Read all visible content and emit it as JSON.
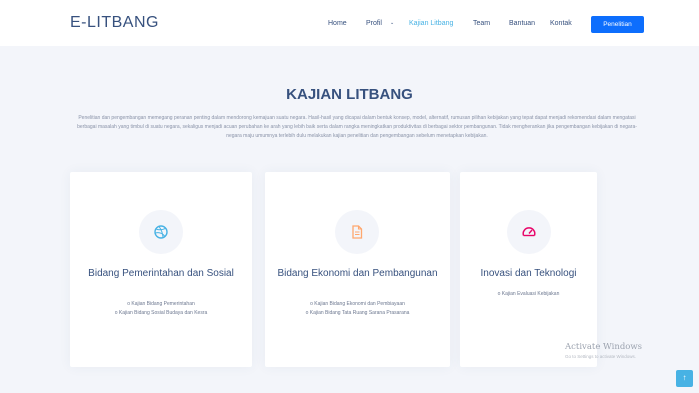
{
  "brand": {
    "logo": "E-LITBANG"
  },
  "nav": {
    "items": [
      {
        "label": "Home"
      },
      {
        "label": "Profil"
      },
      {
        "label": "Kajian Litbang"
      },
      {
        "label": "Team"
      },
      {
        "label": "Bantuan"
      },
      {
        "label": "Kontak"
      }
    ],
    "active": "Kajian Litbang",
    "cta_label": "Penelitian"
  },
  "section": {
    "title": "KAJIAN LITBANG",
    "description": "Penelitian dan pengembangan memegang peranan penting dalam mendorong kemajuan suatu negara. Hasil-hasil yang dicapai dalam bentuk konsep, model, alternatif, rumusan pilihan kebijakan yang tepat dapat menjadi rekomendasi dalam mengatasi berbagai masalah yang timbul di suatu negara, sekaligus menjadi acuan perubahan ke arah yang lebih baik serta dalam rangka meningkatkan produktivitas di berbagai sektor pembangunan. Tidak mengherankan jika pengembangan kebijakan di negara-negara maju umumnya terlebih dulu melakukan kajian penelitian dan pengembangan sebelum menetapkan kebijakan."
  },
  "cards": [
    {
      "icon": "dribbble-icon",
      "title": "Bidang Pemerintahan dan Sosial",
      "items": [
        "o Kajian Bidang Pemerintahan",
        "o Kajian Bidang Sosial Budaya dan Kesra"
      ]
    },
    {
      "icon": "file-icon",
      "title": "Bidang Ekonomi dan Pembangunan",
      "items": [
        "o Kajian Bidang Ekonomi dan Pembiayaan",
        "o Kajian Bidang Tata Ruang Sarana Prasarana"
      ]
    },
    {
      "icon": "speedometer-icon",
      "title": "Inovasi dan Teknologi",
      "items": [
        "o Kajian Evaluasi Kebijakan"
      ]
    }
  ],
  "watermark": {
    "title": "Activate Windows",
    "subtitle": "Go to Settings to activate Windows."
  },
  "back_to_top": {
    "glyph": "↑"
  },
  "colors": {
    "primary": "#37517e",
    "accent": "#47b2e4",
    "cta": "#0d6efd",
    "section_bg": "#f3f5fa",
    "icon_blue": "#47b2e4",
    "icon_orange": "#ffa76e",
    "icon_red": "#e80368"
  }
}
